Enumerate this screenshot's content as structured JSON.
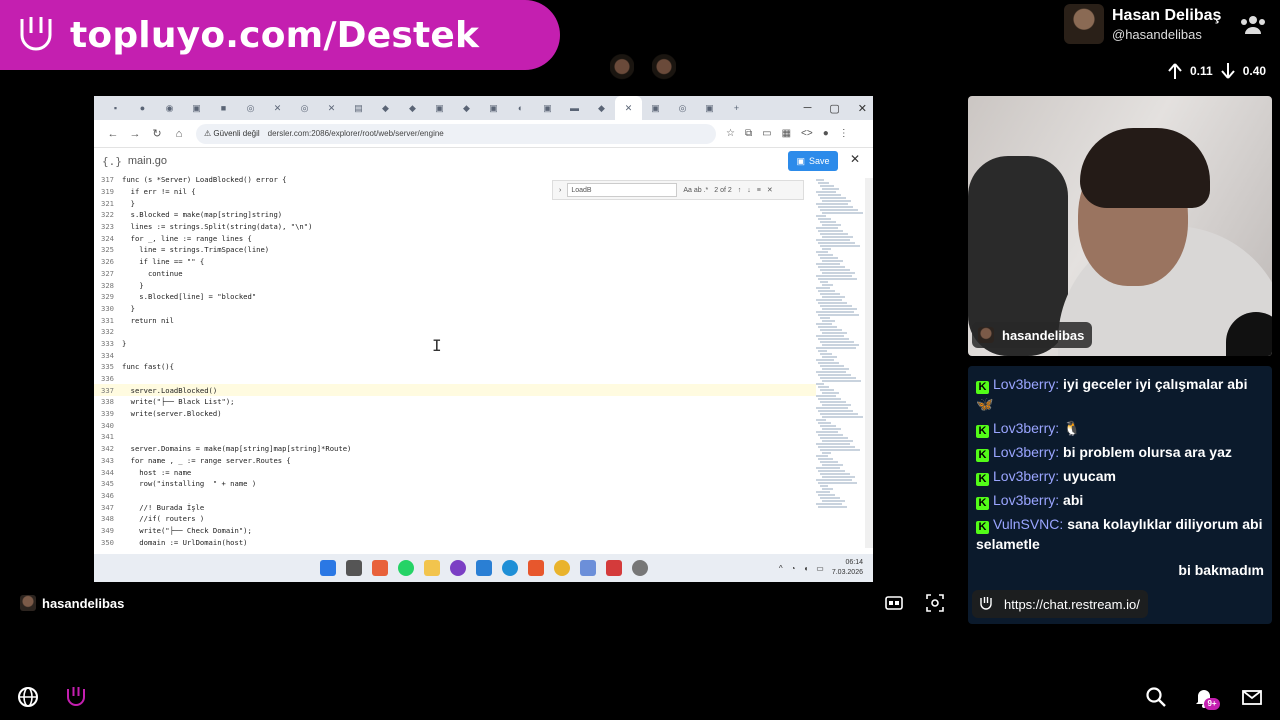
{
  "promo": {
    "text": "topluyo.com/Destek",
    "color": "#c41fb0"
  },
  "profile": {
    "name": "Hasan Delibaş",
    "handle": "@hasandelibas"
  },
  "stats": {
    "up": "0.11",
    "down": "0.40"
  },
  "browser": {
    "url_insecure": "Güvenli değil",
    "url": "dersler.com:2086/explorer/root/web/server/engine",
    "file_icon": "{.}",
    "file_name": "main.go",
    "save_label": "Save",
    "find_query": "LoadB",
    "find_count": "2 of 2",
    "find_opts": "Aa  ab  .*",
    "code_lines": [
      {
        "n": "317",
        "t": "func (s *Server) LoadBlocked() error {"
      },
      {
        "n": "319",
        "t": "  if err != nil {"
      },
      {
        "n": "321",
        "t": "  }"
      },
      {
        "n": "322",
        "t": "  s.Blocked = make(map[string]string)"
      },
      {
        "n": "323",
        "t": "  lines := strings.Split(string(data), \"\\n\")"
      },
      {
        "n": "324",
        "t": "  for _, line := range lines {"
      },
      {
        "n": "325",
        "t": "    line = strings.TrimSpace(line)"
      },
      {
        "n": "326",
        "t": "    if line == \"\" {"
      },
      {
        "n": "327",
        "t": "      continue"
      },
      {
        "n": "328",
        "t": "    }"
      },
      {
        "n": "329",
        "t": "    s.Blocked[line] = \"blocked\""
      },
      {
        "n": "330",
        "t": "  }"
      },
      {
        "n": "331",
        "t": "  return nil"
      },
      {
        "n": "332",
        "t": ""
      },
      {
        "n": "333",
        "t": "}"
      },
      {
        "n": "334",
        "t": ""
      },
      {
        "n": "335",
        "t": "func fast(){"
      },
      {
        "n": "336",
        "t": ""
      },
      {
        "n": "337",
        "t": "  server.LoadBlocked()"
      },
      {
        "n": "338",
        "t": "  write(\"├── Black List\");"
      },
      {
        "n": "339",
        "t": "  write(server.Blocked)"
      },
      {
        "n": "340",
        "t": ""
      },
      {
        "n": "341",
        "t": ""
      },
      {
        "n": "342",
        "t": "  server.Domains = make(map[string]map[string]*Route)"
      },
      {
        "n": "343",
        "t": "  for name , _ := range server.Routes {"
      },
      {
        "n": "344",
        "t": "    host := name"
      },
      {
        "n": "345",
        "t": "    row(\"installing  \" + name )"
      },
      {
        "n": "346",
        "t": ""
      },
      {
        "n": "347",
        "t": "    //! Burada İşle"
      },
      {
        "n": "348",
        "t": "    //if( routers )"
      },
      {
        "n": "349",
        "t": "    write(\"├── Check Domain\");"
      },
      {
        "n": "350",
        "t": "    domain := UrlDomain(host)"
      }
    ],
    "clock_time": "06:14",
    "clock_date": "7.03.2026"
  },
  "stream": {
    "label": "hasandelibas"
  },
  "webcam": {
    "name": "hasandelibas"
  },
  "chat": {
    "messages": [
      {
        "user": "Lov3berry:",
        "text": "iyi geceler iyi çalışmalar abi 🦋"
      },
      {
        "user": "Lov3berry:",
        "text": "🐧"
      },
      {
        "user": "Lov3berry:",
        "text": "bi problem olursa ara yaz"
      },
      {
        "user": "Lov3berry:",
        "text": "uyucam"
      },
      {
        "user": "Lov3berry:",
        "text": "abi"
      },
      {
        "user": "VulnSVNC:",
        "text": "sana kolaylıklar diliyorum abi selametle"
      },
      {
        "user": "",
        "text": "bi bakmadım"
      }
    ],
    "link": "https://chat.restream.io/"
  },
  "notifications": {
    "badge": "9+"
  }
}
